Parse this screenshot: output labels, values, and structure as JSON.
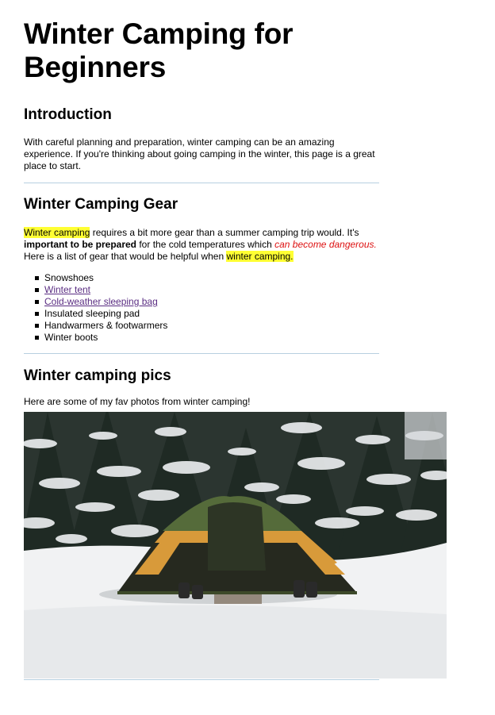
{
  "title_line1": "Winter Camping for",
  "title_line2": "Beginners",
  "intro": {
    "heading": "Introduction",
    "text": "With careful planning and preparation, winter camping can be an amazing experience. If you're thinking about going camping in the winter, this page is a great place to start."
  },
  "gear": {
    "heading": "Winter Camping Gear",
    "p_hl1": "Winter camping",
    "p_part1": " requires a bit more gear than a summer camping trip would. It's ",
    "p_bold": "important to be prepared",
    "p_part2": " for the cold temperatures which ",
    "p_red": "can become dangerous.",
    "p_part3": " Here is a list of gear that would be helpful when ",
    "p_hl2": "winter camping.",
    "items": [
      {
        "label": "Snowshoes"
      },
      {
        "label": "Winter tent"
      },
      {
        "label": "Cold-weather sleeping bag"
      },
      {
        "label": "Insulated sleeping pad"
      },
      {
        "label": "Handwarmers & footwarmers"
      },
      {
        "label": "Winter boots"
      }
    ]
  },
  "pics": {
    "heading": "Winter camping pics",
    "text": "Here are some of my fav photos from winter camping!"
  },
  "colors": {
    "highlight": "#ffff33",
    "emphasis_red": "#dd1111",
    "link": "#5a2d82",
    "separator": "#b7cfe0"
  }
}
